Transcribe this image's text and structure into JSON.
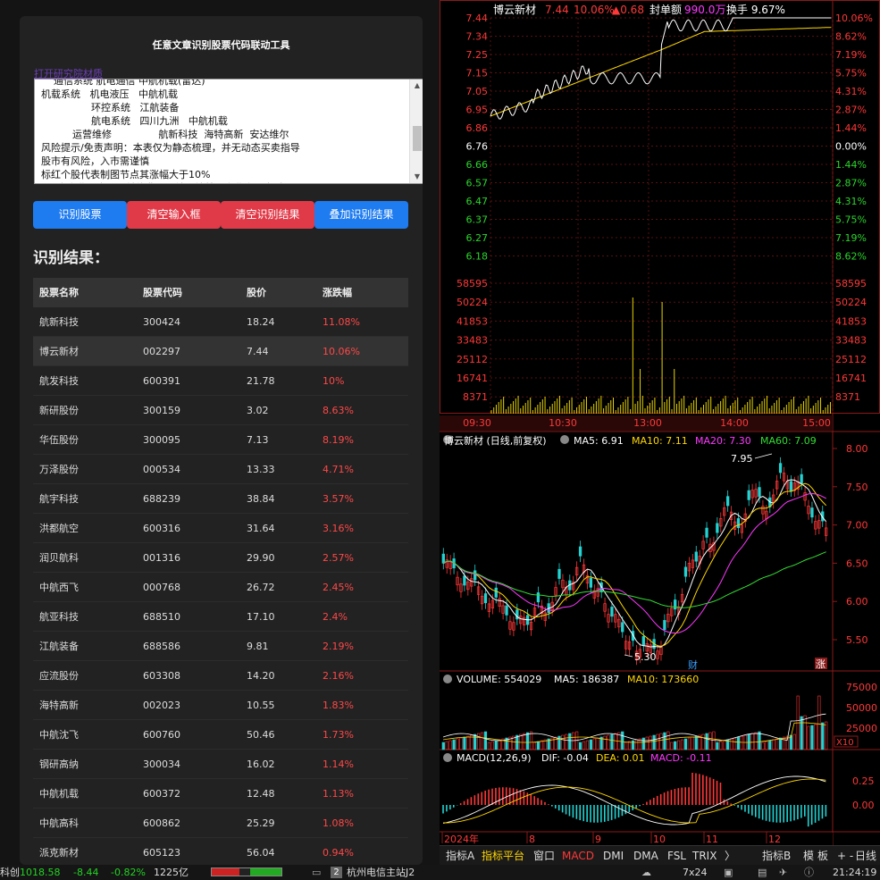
{
  "panel": {
    "title": "任意文章识别股票代码联动工具",
    "open_link": "打开研究院材质",
    "textarea_lines": [
      "    通信系统 航电通信 中航机载(雷达)",
      "机载系统   机电液压   中航机载",
      "                环控系统   江航装备",
      "                航电系统   四川九洲   中航机载",
      "          运营维修               航新科技  海特高新  安达维尔",
      "风险提示/免责声明：本表仅为静态梳理，并无动态买卖指导",
      "股市有风险，入市需谨慎",
      "标红个股代表制图节点其涨幅大于10%",
      "  更多产业图表，可前往非研公社网站首页产业库）查看"
    ],
    "buttons": {
      "identify": "识别股票",
      "clear_input": "清空输入框",
      "clear_result": "清空识别结果",
      "append": "叠加识别结果"
    },
    "result_title": "识别结果：",
    "table": {
      "headers": [
        "股票名称",
        "股票代码",
        "股价",
        "涨跌幅"
      ],
      "rows": [
        [
          "航新科技",
          "300424",
          "18.24",
          "11.08%"
        ],
        [
          "博云新材",
          "002297",
          "7.44",
          "10.06%"
        ],
        [
          "航发科技",
          "600391",
          "21.78",
          "10%"
        ],
        [
          "新研股份",
          "300159",
          "3.02",
          "8.63%"
        ],
        [
          "华伍股份",
          "300095",
          "7.13",
          "8.19%"
        ],
        [
          "万泽股份",
          "000534",
          "13.33",
          "4.71%"
        ],
        [
          "航宇科技",
          "688239",
          "38.84",
          "3.57%"
        ],
        [
          "洪都航空",
          "600316",
          "31.64",
          "3.16%"
        ],
        [
          "润贝航科",
          "001316",
          "29.90",
          "2.57%"
        ],
        [
          "中航西飞",
          "000768",
          "26.72",
          "2.45%"
        ],
        [
          "航亚科技",
          "688510",
          "17.10",
          "2.4%"
        ],
        [
          "江航装备",
          "688586",
          "9.81",
          "2.19%"
        ],
        [
          "应流股份",
          "603308",
          "14.20",
          "2.16%"
        ],
        [
          "海特高新",
          "002023",
          "10.55",
          "1.83%"
        ],
        [
          "中航沈飞",
          "600760",
          "50.46",
          "1.73%"
        ],
        [
          "钢研高纳",
          "300034",
          "16.02",
          "1.14%"
        ],
        [
          "中航机载",
          "600372",
          "12.48",
          "1.13%"
        ],
        [
          "中航高科",
          "600862",
          "25.29",
          "1.08%"
        ],
        [
          "派克新材",
          "605123",
          "56.04",
          "0.94%"
        ]
      ]
    }
  },
  "intraday": {
    "name": "博云新材",
    "price": "7.44",
    "pct": "10.06%",
    "change": "▲0.68",
    "seal_label": "封单额",
    "seal_value": "990.0万",
    "turnover": "换手 9.67%",
    "price_ticks_up": [
      "7.44",
      "7.34",
      "7.25",
      "7.15",
      "7.05",
      "6.95",
      "6.86"
    ],
    "price_ref": "6.76",
    "price_ticks_down": [
      "6.66",
      "6.57",
      "6.47",
      "6.37",
      "6.27",
      "6.18"
    ],
    "pct_ticks_up": [
      "10.06%",
      "8.62%",
      "7.19%",
      "5.75%",
      "4.31%",
      "2.87%",
      "1.44%"
    ],
    "pct_ref": "0.00%",
    "pct_ticks_down": [
      "1.44%",
      "2.87%",
      "4.31%",
      "5.75%",
      "7.19%",
      "8.62%"
    ],
    "vol_ticks": [
      "58595",
      "50224",
      "41853",
      "33483",
      "25112",
      "16741",
      "8371"
    ],
    "time_ticks": [
      "09:30",
      "10:30",
      "13:00",
      "14:00",
      "15:00"
    ]
  },
  "daily": {
    "header_name": "博云新材 (日线,前复权)",
    "ma5": "MA5: 6.91",
    "ma10": "MA10: 7.11",
    "ma20": "MA20: 7.30",
    "ma60": "MA60: 7.09",
    "price_ticks": [
      "8.00",
      "7.50",
      "7.00",
      "6.50",
      "6.00",
      "5.50"
    ],
    "high_label": "7.95",
    "low_label": "5.30",
    "cai_label": "财",
    "zhang_label": "涨"
  },
  "volume": {
    "label": "VOLUME: 554029",
    "ma5": "MA5: 186387",
    "ma10": "MA10: 173660",
    "ticks": [
      "75000",
      "50000",
      "25000"
    ],
    "unit": "X10"
  },
  "macd": {
    "label": "MACD(12,26,9)",
    "dif": "DIF: -0.04",
    "dea": "DEA: 0.01",
    "macd": "MACD: -0.11",
    "ticks": [
      "0.25",
      "0.00"
    ],
    "x_ticks": [
      "2024年",
      "8",
      "9",
      "10",
      "11",
      "12"
    ]
  },
  "tabs": {
    "items": [
      "指标A",
      "指标平台",
      "窗口",
      "MACD",
      "DMI",
      "DMA",
      "FSL",
      "TRIX",
      "〉",
      "指标B",
      "模",
      "板"
    ],
    "plus_minus": "+ -",
    "period": "日线"
  },
  "status": {
    "index_name": "科创",
    "index_value": "1018.58",
    "index_change": "-8.44",
    "index_pct": "-0.82%",
    "amount": "1225亿",
    "server_num": "2",
    "server": "杭州电信主站J2",
    "layout": "7x24",
    "time": "21:24:19"
  },
  "colors": {
    "up": "#ff3838",
    "down": "#22d3d3",
    "green": "#2bd52b",
    "ma_white": "#ffffff",
    "ma_yellow": "#ffd700",
    "ma_magenta": "#ff38ff",
    "ma_green": "#33dd33",
    "blue_btn": "#1e7bf0",
    "red_btn": "#e03a48"
  }
}
